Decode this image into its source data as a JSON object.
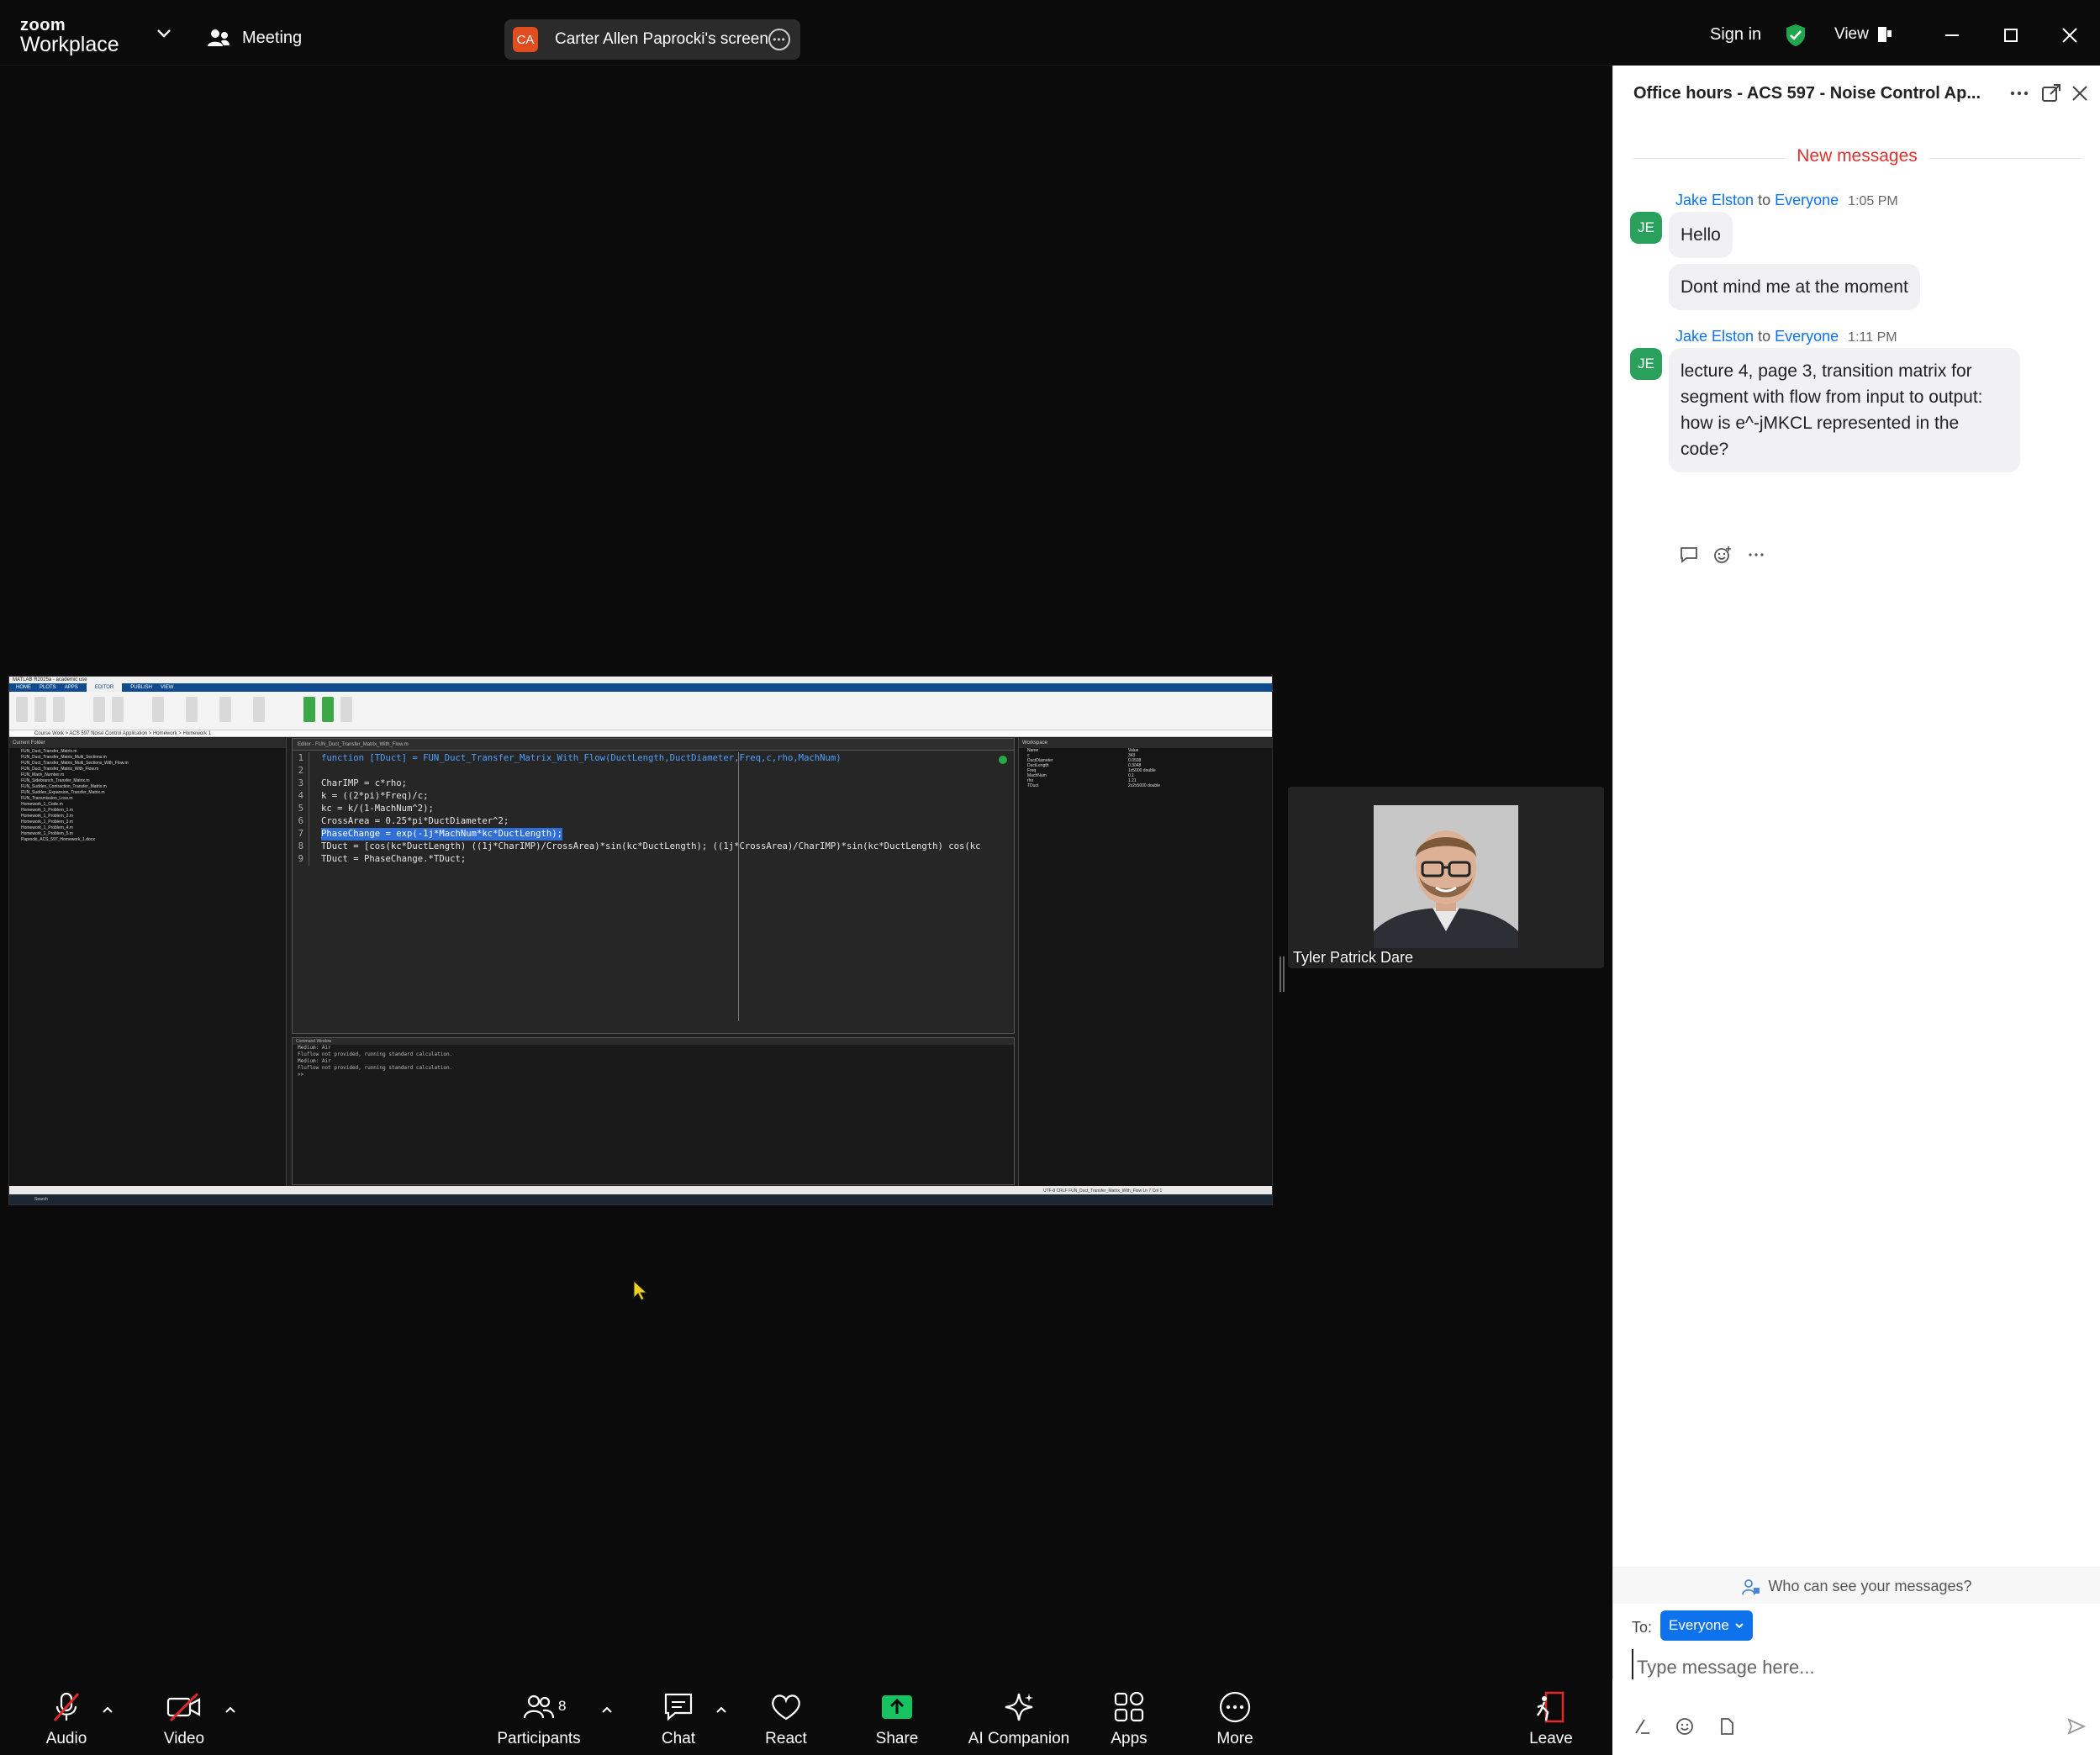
{
  "app": {
    "logo_zoom": "zoom",
    "logo_workplace": "Workplace",
    "meeting_label": "Meeting",
    "share_initials": "CA",
    "share_name": "Carter Allen Paprocki's screen",
    "sign_in": "Sign in",
    "view": "View"
  },
  "matlab": {
    "title": "MATLAB R2025a - academic use",
    "tabs": [
      "HOME",
      "PLOTS",
      "APPS",
      "EDITOR",
      "PUBLISH",
      "VIEW"
    ],
    "path": "Course Work > ACS 597 Noise Control Application > Homework > Homework 1",
    "files_header": "Current Folder",
    "files": [
      "FUN_Duct_Transfer_Matrix.m",
      "FUN_Duct_Transfer_Matrix_Multi_Sections.m",
      "FUN_Duct_Transfer_Matrix_Multi_Sections_With_Flow.m",
      "FUN_Duct_Transfer_Matrix_With_Flow.m",
      "FUN_Mach_Number.m",
      "FUN_Sidebranch_Transfer_Matrix.m",
      "FUN_Sudden_Contraction_Transfer_Matrix.m",
      "FUN_Sudden_Expansion_Transfer_Matrix.m",
      "FUN_Transmission_Loss.m",
      "Homework_1_Code.m",
      "Homework_1_Problem_1.m",
      "Homework_1_Problem_2.m",
      "Homework_1_Problem_3.m",
      "Homework_1_Problem_4.m",
      "Homework_1_Problem_5.m",
      "Paprocki_ACS_597_Homework_1.docx"
    ],
    "editor_tabs": "Editor - FUN_Duct_Transfer_Matrix_With_Flow.m",
    "code": [
      {
        "n": "1",
        "t": "function [TDuct] = FUN_Duct_Transfer_Matrix_With_Flow(DuctLength,DuctDiameter,Freq,c,rho,MachNum)"
      },
      {
        "n": "2",
        "t": ""
      },
      {
        "n": "3",
        "t": "CharIMP = c*rho;"
      },
      {
        "n": "4",
        "t": "k = ((2*pi)*Freq)/c;"
      },
      {
        "n": "5",
        "t": "kc = k/(1-MachNum^2);"
      },
      {
        "n": "6",
        "t": "CrossArea = 0.25*pi*DuctDiameter^2;"
      },
      {
        "n": "7",
        "t": "PhaseChange = exp(-1j*MachNum*kc*DuctLength);"
      },
      {
        "n": "8",
        "t": "TDuct = [cos(kc*DuctLength) ((1j*CharIMP)/CrossArea)*sin(kc*DuctLength); ((1j*CrossArea)/CharIMP)*sin(kc*DuctLength) cos(kc"
      },
      {
        "n": "9",
        "t": "TDuct = PhaseChange.*TDuct;"
      }
    ],
    "cmd_header": "Command Window",
    "cmd_lines": [
      "Medium: Air",
      "Fluflow not provided, running standard calculation.",
      "Medium: Air",
      "Fluflow not provided, running standard calculation.",
      ">>"
    ],
    "ws_header": "Workspace",
    "ws_cols": [
      "Name",
      "Value"
    ],
    "ws_rows": [
      [
        "c",
        "343"
      ],
      [
        "DuctDiameter",
        "0.0508"
      ],
      [
        "DuctLength",
        "0.3048"
      ],
      [
        "Freq",
        "1x5000 double"
      ],
      [
        "MachNum",
        "0.1"
      ],
      [
        "rho",
        "1.21"
      ],
      [
        "TDuct",
        "2x2x5000 double"
      ]
    ],
    "status": "UTF-8   CRLF   FUN_Duct_Transfer_Matrix_With_Flow   Ln 7   Col 1",
    "taskbar": "Search"
  },
  "video": {
    "participant_name": "Tyler Patrick Dare"
  },
  "chat": {
    "title": "Office hours - ACS 597 - Noise Control Ap...",
    "new_messages": "New messages",
    "messages": [
      {
        "initials": "JE",
        "sender": "Jake Elston",
        "to_word": "to",
        "recipient": "Everyone",
        "time": "1:05 PM",
        "bubbles": [
          "Hello",
          "Dont mind me at the moment"
        ]
      },
      {
        "initials": "JE",
        "sender": "Jake Elston",
        "to_word": "to",
        "recipient": "Everyone",
        "time": "1:11 PM",
        "bubbles": [
          "lecture 4, page 3, transition matrix for segment with flow from input to output: how is e^-jMKCL represented in the code?"
        ]
      }
    ],
    "who_can_see": "Who can see your messages?",
    "to_label": "To:",
    "to_value": "Everyone",
    "input_placeholder": "Type message here..."
  },
  "toolbar": {
    "audio": "Audio",
    "video": "Video",
    "participants": "Participants",
    "participants_count": "8",
    "chat": "Chat",
    "react": "React",
    "share": "Share",
    "ai_companion": "AI Companion",
    "apps": "Apps",
    "more": "More",
    "leave": "Leave"
  },
  "colors": {
    "accent_blue": "#0e72ed",
    "share_green": "#17c360",
    "new_msg_red": "#e0302e",
    "avatar_green": "#2aa05d",
    "muted_red": "#e02828"
  }
}
